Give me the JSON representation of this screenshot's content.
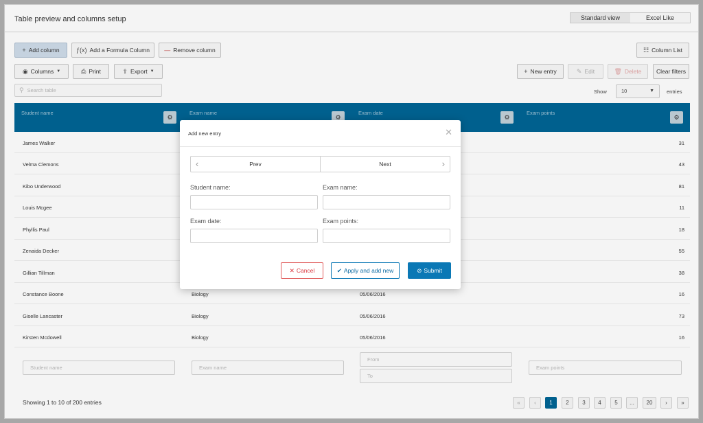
{
  "header": {
    "title": "Table preview and columns setup",
    "views": [
      "Standard view",
      "Excel Like"
    ]
  },
  "toolbar": {
    "add_column": "Add column",
    "add_formula_column": "Add a Formula Column",
    "remove_column": "Remove column",
    "column_list": "Column List",
    "columns": "Columns",
    "print": "Print",
    "export": "Export",
    "new_entry": "New entry",
    "edit": "Edit",
    "delete": "Delete",
    "clear_filters": "Clear filters"
  },
  "search": {
    "placeholder": "Search table"
  },
  "show": {
    "label": "Show",
    "value": "10",
    "suffix": "entries"
  },
  "columns": [
    "Student name",
    "Exam name",
    "Exam date",
    "Exam points"
  ],
  "rows": [
    [
      "James Walker",
      "",
      "",
      "31"
    ],
    [
      "Velma Clemons",
      "",
      "",
      "43"
    ],
    [
      "Kibo Underwood",
      "",
      "",
      "81"
    ],
    [
      "Louis Mcgee",
      "",
      "",
      "11"
    ],
    [
      "Phyllis Paul",
      "",
      "",
      "18"
    ],
    [
      "Zenaida Decker",
      "",
      "",
      "55"
    ],
    [
      "Gillian Tillman",
      "",
      "",
      "38"
    ],
    [
      "Constance Boone",
      "Biology",
      "05/06/2016",
      "16"
    ],
    [
      "Giselle Lancaster",
      "Biology",
      "05/06/2016",
      "73"
    ],
    [
      "Kirsten Mcdowell",
      "Biology",
      "05/06/2016",
      "16"
    ]
  ],
  "filters": {
    "student_name": "Student name",
    "exam_name": "Exam name",
    "date_from": "From",
    "date_to": "To",
    "exam_points": "Exam points"
  },
  "footer": {
    "info": "Showing 1 to 10 of 200 entries",
    "pages": [
      "1",
      "2",
      "3",
      "4",
      "5",
      "...",
      "20"
    ],
    "current_page": "1"
  },
  "modal": {
    "title": "Add new entry",
    "prev": "Prev",
    "next": "Next",
    "labels": {
      "student_name": "Student name:",
      "exam_name": "Exam name:",
      "exam_date": "Exam date:",
      "exam_points": "Exam points:"
    },
    "cancel": "Cancel",
    "apply_and_add_new": "Apply and add new",
    "submit": "Submit"
  },
  "colors": {
    "header_blue": "#00608e",
    "primary": "#0b78b5",
    "danger": "#d9363e"
  }
}
